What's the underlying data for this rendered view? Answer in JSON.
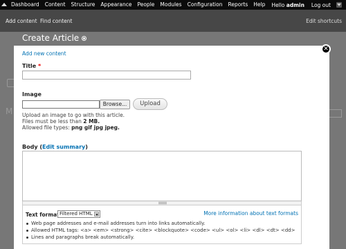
{
  "toolbar": {
    "menu": [
      "Dashboard",
      "Content",
      "Structure",
      "Appearance",
      "People",
      "Modules",
      "Configuration",
      "Reports",
      "Help"
    ],
    "greeting": "Hello",
    "username": "admin",
    "logout": "Log out"
  },
  "shortcuts": {
    "items": [
      "Add content",
      "Find content"
    ],
    "edit": "Edit shortcuts"
  },
  "overlay": {
    "title": "Create Article",
    "breadcrumb": "Add new content"
  },
  "form": {
    "title_label": "Title",
    "required_mark": "*",
    "title_value": "",
    "image_label": "Image",
    "browse_label": "Browse...",
    "upload_label": "Upload",
    "image_help": "Upload an image to go with this article.",
    "size_prefix": "Files must be less than",
    "size_value": "2 MB.",
    "types_prefix": "Allowed file types:",
    "types_value": "png gif jpg jpeg.",
    "body_label": "Body",
    "body_open": "(",
    "edit_summary": "Edit summary",
    "body_close": ")",
    "format_label": "Text format",
    "format_selected": "Filtered HTML",
    "format_more": "More information about text formats",
    "tips": [
      "Web page addresses and e-mail addresses turn into links automatically.",
      "Allowed HTML tags: <a> <em> <strong> <cite> <blockquote> <code> <ul> <ol> <li> <dl> <dt> <dd>",
      "Lines and paragraphs break automatically."
    ]
  },
  "icons": {
    "close": "close-icon",
    "shortcut_star": "star-icon",
    "home": "home-icon",
    "toggle": "chevron-down-icon"
  },
  "colors": {
    "toolbar": "#0b0b0b",
    "shortcut_bar": "#474747",
    "link": "#0071b3",
    "required": "#e00000"
  }
}
